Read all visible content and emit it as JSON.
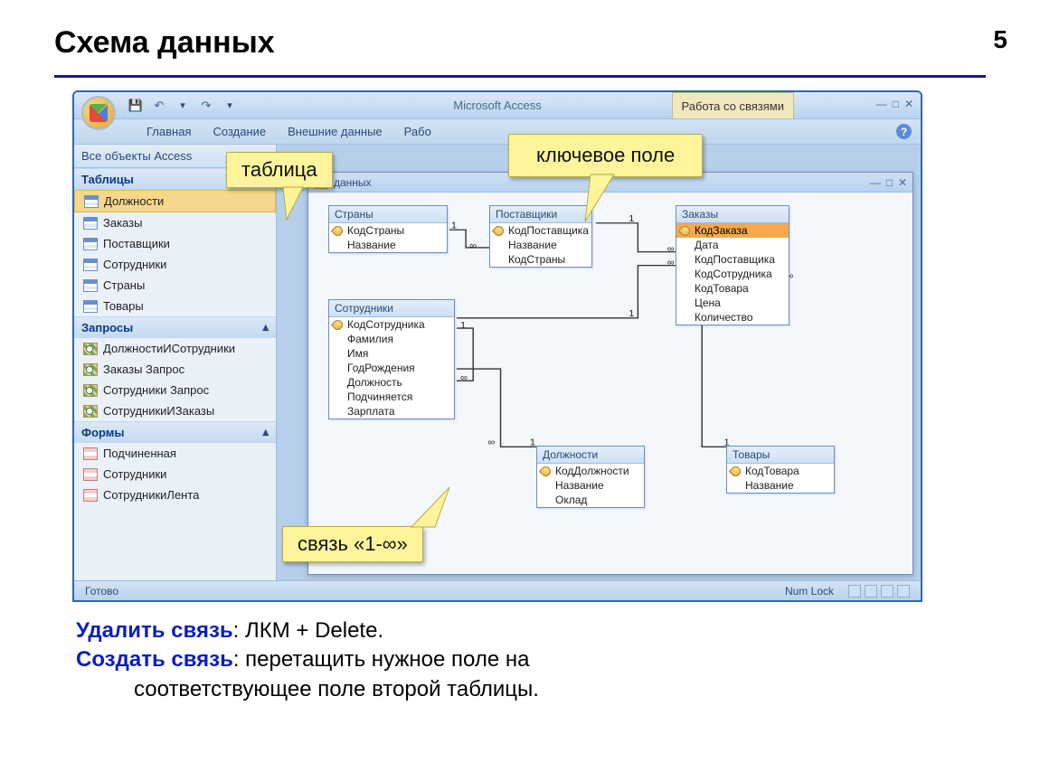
{
  "page_number": "5",
  "slide_title": "Схема данных",
  "app_title": "Microsoft Access",
  "context_tab": "Работа со связями",
  "ribbon_tabs": [
    "Главная",
    "Создание",
    "Внешние данные",
    "Рабо"
  ],
  "navpane": {
    "header": "Все объекты Access",
    "groups": [
      {
        "title": "Таблицы",
        "type": "table",
        "items": [
          "Должности",
          "Заказы",
          "Поставщики",
          "Сотрудники",
          "Страны",
          "Товары"
        ],
        "selected": 0
      },
      {
        "title": "Запросы",
        "type": "query",
        "items": [
          "ДолжностиИСотрудники",
          "Заказы Запрос",
          "Сотрудники Запрос",
          "СотрудникиИЗаказы"
        ]
      },
      {
        "title": "Формы",
        "type": "form",
        "items": [
          "Подчиненная",
          "Сотрудники",
          "СотрудникиЛента"
        ]
      }
    ]
  },
  "child_title_suffix": "данных",
  "tables": {
    "strany": {
      "title": "Страны",
      "fields": [
        {
          "n": "КодСтраны",
          "k": true
        },
        {
          "n": "Название"
        }
      ]
    },
    "postav": {
      "title": "Поставщики",
      "fields": [
        {
          "n": "КодПоставщика",
          "k": true
        },
        {
          "n": "Название"
        },
        {
          "n": "КодСтраны"
        }
      ]
    },
    "zakazy": {
      "title": "Заказы",
      "fields": [
        {
          "n": "КодЗаказа",
          "k": true,
          "sel": true
        },
        {
          "n": "Дата"
        },
        {
          "n": "КодПоставщика"
        },
        {
          "n": "КодСотрудника"
        },
        {
          "n": "КодТовара"
        },
        {
          "n": "Цена"
        },
        {
          "n": "Количество"
        }
      ]
    },
    "sotr": {
      "title": "Сотрудники",
      "fields": [
        {
          "n": "КодСотрудника",
          "k": true
        },
        {
          "n": "Фамилия"
        },
        {
          "n": "Имя"
        },
        {
          "n": "ГодРождения"
        },
        {
          "n": "Должность"
        },
        {
          "n": "Подчиняется"
        },
        {
          "n": "Зарплата"
        }
      ]
    },
    "dolzh": {
      "title": "Должности",
      "fields": [
        {
          "n": "КодДолжности",
          "k": true
        },
        {
          "n": "Название"
        },
        {
          "n": "Оклад"
        }
      ]
    },
    "tovary": {
      "title": "Товары",
      "fields": [
        {
          "n": "КодТовара",
          "k": true
        },
        {
          "n": "Название"
        }
      ]
    }
  },
  "rel_labels": {
    "one": "1",
    "many": "∞"
  },
  "callouts": {
    "table": "таблица",
    "keyfield": "ключевое поле",
    "relation": "связь «1-∞»"
  },
  "status": {
    "left": "Готово",
    "right": "Num Lock"
  },
  "instructions": {
    "delete_label": "Удалить связь",
    "delete_text": ": ЛКМ + Delete.",
    "create_label": "Создать связь",
    "create_text_1": ": перетащить нужное поле на",
    "create_text_2": "соответствующее поле второй таблицы."
  }
}
